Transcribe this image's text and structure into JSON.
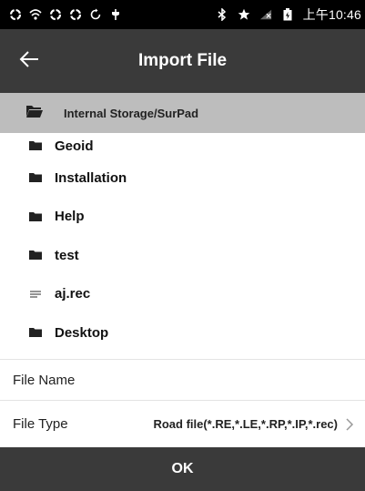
{
  "status_bar": {
    "time": "上午10:46",
    "icons": [
      "app-icon",
      "signal-app-icon",
      "app-icon",
      "app-icon",
      "sync-icon",
      "usb-icon",
      "bluetooth-icon",
      "star-icon",
      "no-signal-icon",
      "battery-icon"
    ]
  },
  "header": {
    "title": "Import File",
    "back_icon": "back-arrow-icon"
  },
  "path": {
    "label": "Internal Storage/SurPad",
    "icon": "open-folder-icon"
  },
  "files": [
    {
      "name": "Geoid",
      "icon": "folder-icon"
    },
    {
      "name": "Installation",
      "icon": "folder-icon"
    },
    {
      "name": "Help",
      "icon": "folder-icon"
    },
    {
      "name": "test",
      "icon": "folder-icon"
    },
    {
      "name": "aj.rec",
      "icon": "file-icon"
    },
    {
      "name": "Desktop",
      "icon": "folder-icon"
    }
  ],
  "form": {
    "file_name_label": "File Name",
    "file_name_value": "",
    "file_type_label": "File Type",
    "file_type_value": "Road file(*.RE,*.LE,*.RP,*.IP,*.rec)"
  },
  "actions": {
    "ok_label": "OK"
  },
  "colors": {
    "status_bar": "#000000",
    "app_bar": "#3a3a3a",
    "path_bar": "#bdbdbd",
    "text": "#111111"
  }
}
